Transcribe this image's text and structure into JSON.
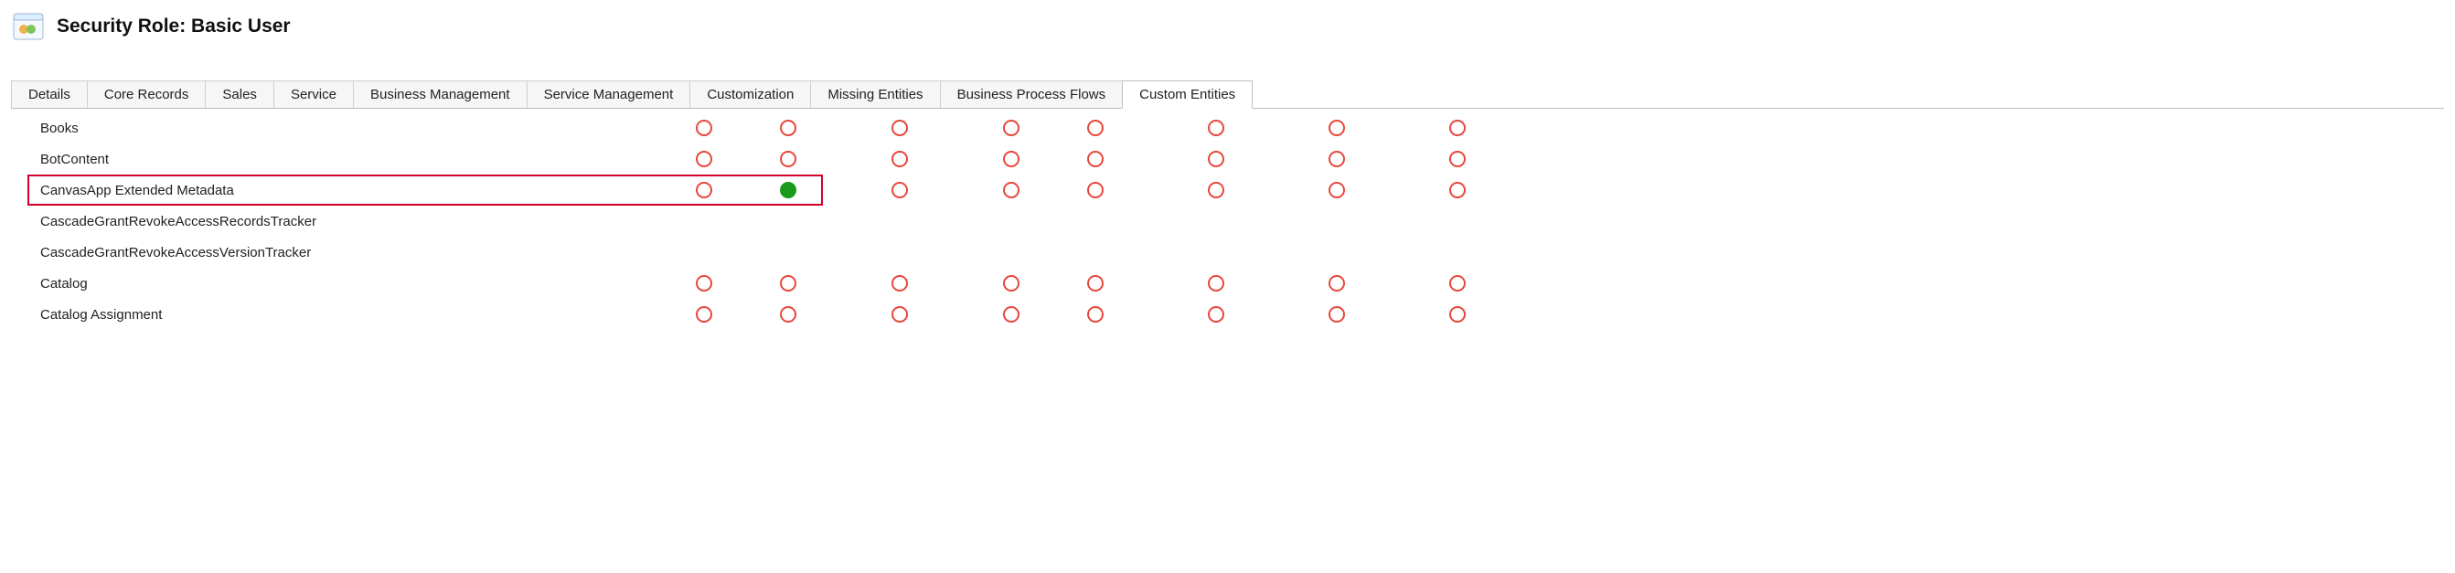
{
  "header": {
    "title": "Security Role: Basic User"
  },
  "tabs": [
    {
      "label": "Details"
    },
    {
      "label": "Core Records"
    },
    {
      "label": "Sales"
    },
    {
      "label": "Service"
    },
    {
      "label": "Business Management"
    },
    {
      "label": "Service Management"
    },
    {
      "label": "Customization"
    },
    {
      "label": "Missing Entities"
    },
    {
      "label": "Business Process Flows"
    },
    {
      "label": "Custom Entities",
      "active": true
    }
  ],
  "entities": [
    {
      "name": "Books",
      "highlighted": false,
      "privileges": [
        "none",
        "none",
        "none",
        "none",
        "none",
        "none",
        "none",
        "none"
      ]
    },
    {
      "name": "BotContent",
      "highlighted": false,
      "privileges": [
        "none",
        "none",
        "none",
        "none",
        "none",
        "none",
        "none",
        "none"
      ]
    },
    {
      "name": "CanvasApp Extended Metadata",
      "highlighted": true,
      "privileges": [
        "none",
        "full",
        "none",
        "none",
        "none",
        "none",
        "none",
        "none"
      ]
    },
    {
      "name": "CascadeGrantRevokeAccessRecordsTracker",
      "highlighted": false,
      "privileges": []
    },
    {
      "name": "CascadeGrantRevokeAccessVersionTracker",
      "highlighted": false,
      "privileges": []
    },
    {
      "name": "Catalog",
      "highlighted": false,
      "privileges": [
        "none",
        "none",
        "none",
        "none",
        "none",
        "none",
        "none",
        "none"
      ]
    },
    {
      "name": "Catalog Assignment",
      "highlighted": false,
      "privileges": [
        "none",
        "none",
        "none",
        "none",
        "none",
        "none",
        "none",
        "none"
      ]
    }
  ]
}
